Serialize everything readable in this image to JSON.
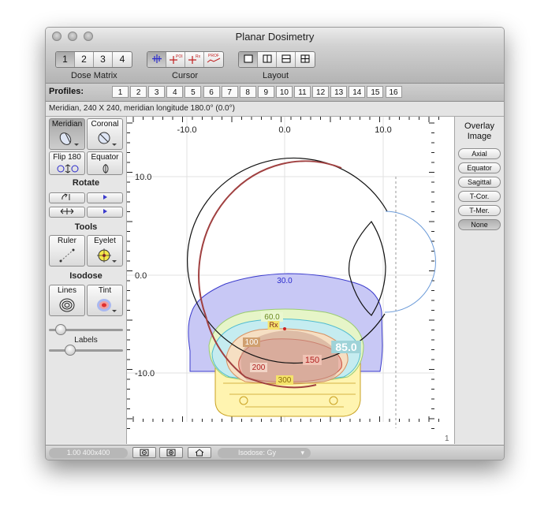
{
  "window": {
    "title": "Planar Dosimetry"
  },
  "toolbar": {
    "dose_matrix": {
      "label": "Dose Matrix",
      "options": [
        "1",
        "2",
        "3",
        "4"
      ],
      "selected": "1"
    },
    "cursor": {
      "label": "Cursor",
      "icons": [
        "crosshair-icon",
        "poi-cursor-icon",
        "rx-cursor-icon",
        "profile-cursor-icon"
      ],
      "small_labels": [
        "POI",
        "Rx",
        "PROF"
      ]
    },
    "layout": {
      "label": "Layout",
      "icons": [
        "single-pane-icon",
        "two-pane-icon",
        "stacked-pane-icon",
        "four-pane-icon"
      ]
    }
  },
  "profiles": {
    "label": "Profiles:",
    "items": [
      "1",
      "2",
      "3",
      "4",
      "5",
      "6",
      "7",
      "8",
      "9",
      "10",
      "11",
      "12",
      "13",
      "14",
      "15",
      "16"
    ]
  },
  "info": {
    "text": "Meridian, 240 X 240, meridian longitude 180.0° (0.0°)"
  },
  "left_panel": {
    "view_buttons": [
      {
        "label": "Meridian",
        "selected": true
      },
      {
        "label": "Coronal",
        "selected": false
      },
      {
        "label": "Flip 180",
        "selected": false
      },
      {
        "label": "Equator",
        "selected": false
      }
    ],
    "rotate": {
      "label": "Rotate"
    },
    "tools": {
      "label": "Tools",
      "ruler": "Ruler",
      "eyelet": "Eyelet"
    },
    "isodose": {
      "label": "Isodose",
      "lines": "Lines",
      "tint": "Tint"
    },
    "labels_slider": {
      "label": "Labels"
    },
    "slider_top_value": 0.1,
    "slider_labels_value": 0.25
  },
  "plot": {
    "x_ticks": [
      "-10.0",
      "0.0",
      "10.0"
    ],
    "y_ticks": [
      "10.0",
      "0.0",
      "-10.0"
    ],
    "isodose_labels": {
      "iso30": "30.0",
      "iso60": "60.0",
      "rx": "Rx",
      "iso100": "100",
      "iso85": "85.0",
      "iso150": "150",
      "iso200": "200",
      "iso300": "300"
    },
    "corner_value": "1",
    "colors": {
      "iso30": "#c8c8f5",
      "iso60": "#e6f5c8",
      "iso85": "#c5ecf0",
      "iso100": "#f6dfc3",
      "iso150": "#eab7aa",
      "iso300": "#ffffb0",
      "eye_outline": "#a04040"
    }
  },
  "overlay": {
    "title_line1": "Overlay",
    "title_line2": "Image",
    "options": [
      "Axial",
      "Equator",
      "Sagittal",
      "T-Cor.",
      "T-Mer.",
      "None"
    ],
    "selected": "None"
  },
  "status": {
    "zoom": "1.00 400x400",
    "isodose_select": "Isodose: Gy"
  }
}
